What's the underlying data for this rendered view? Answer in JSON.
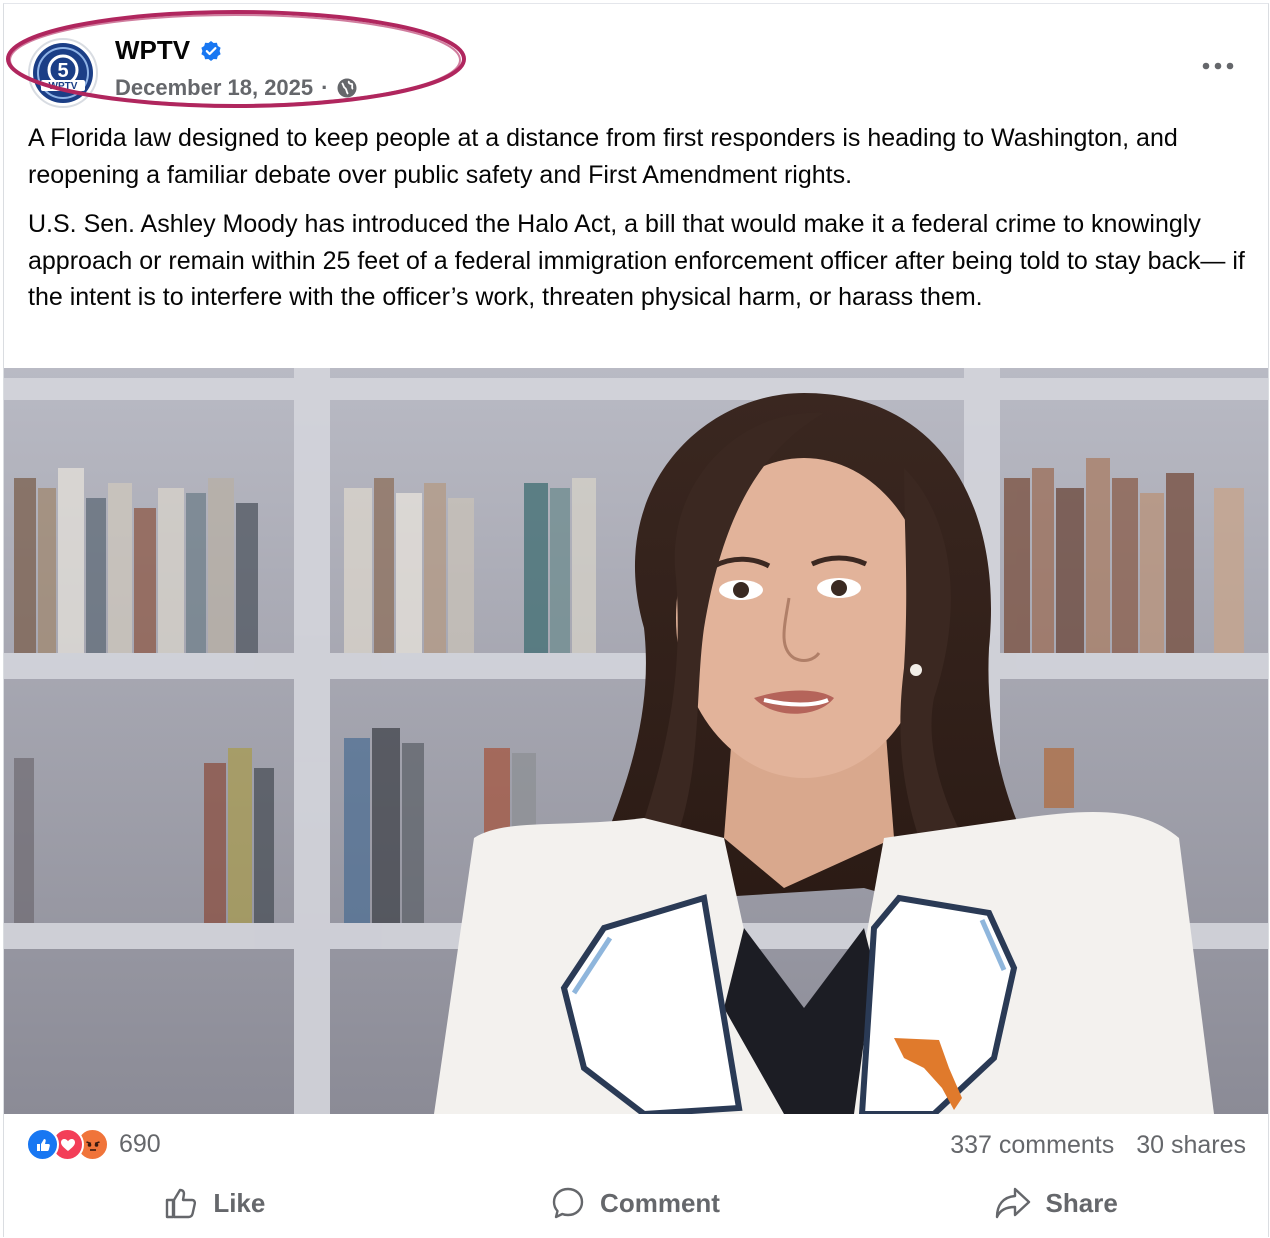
{
  "post": {
    "page_name": "WPTV",
    "date": "December 18, 2025",
    "separator": "·",
    "logo_text": "WPTV",
    "logo_number": "5",
    "paragraphs": [
      "A Florida law designed to keep people at a distance from first responders is heading to Washington, and reopening a familiar debate over public safety and First Amendment rights.",
      "U.S. Sen. Ashley Moody has introduced the Halo Act, a bill that would make it a federal crime to knowingly approach or remain within 25 feet of a federal immigration enforcement officer after being told to stay back— if the intent is to interfere with the officer’s work, threaten physical harm, or harass them."
    ]
  },
  "engagement": {
    "reaction_count": "690",
    "comments": "337 comments",
    "shares": "30 shares",
    "reaction_icons": [
      "like-icon",
      "love-icon",
      "angry-icon"
    ]
  },
  "actions": {
    "like": "Like",
    "comment": "Comment",
    "share": "Share"
  },
  "colors": {
    "annotation_oval": "#b0265e",
    "verified": "#1877f2",
    "secondary_text": "#65676b"
  }
}
